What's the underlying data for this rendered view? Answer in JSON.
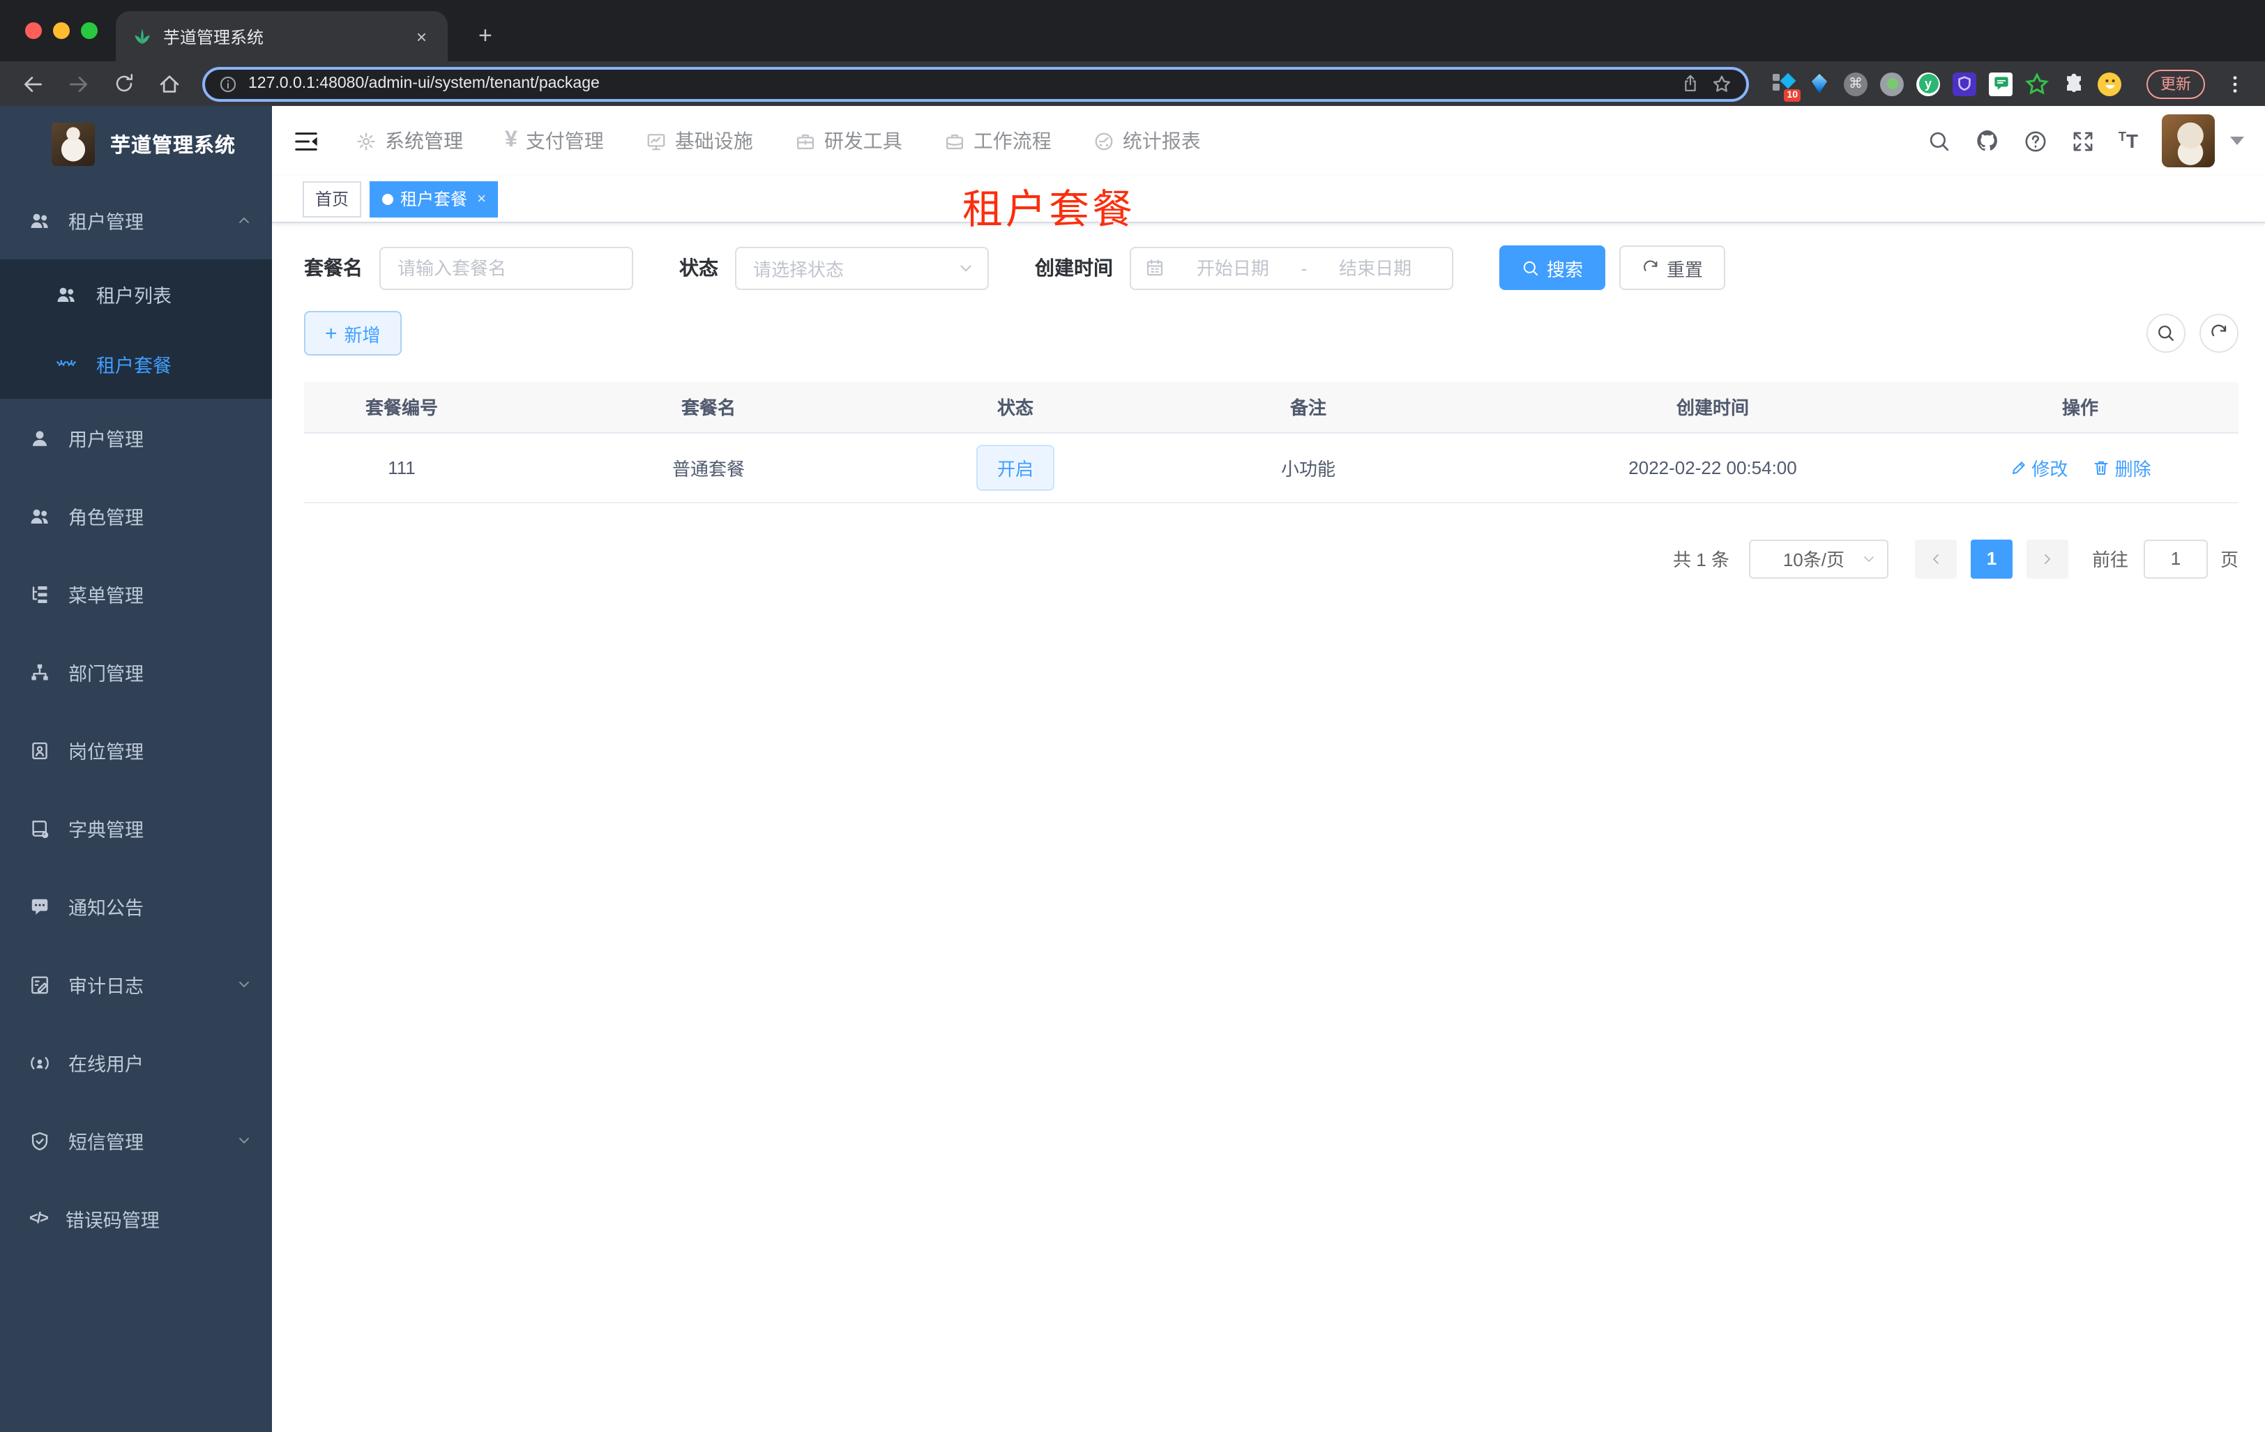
{
  "browser": {
    "tab_title": "芋道管理系统",
    "close_tab": "×",
    "new_tab_button": "+",
    "url": "127.0.0.1:48080/admin-ui/system/tenant/package",
    "extension_badge": "10",
    "ext_y_letter": "y",
    "command_glyph": "⌘",
    "update_button": "更新"
  },
  "header": {
    "nav": [
      {
        "label": "系统管理",
        "icon": "gear-icon"
      },
      {
        "label": "支付管理",
        "icon": "yen-icon"
      },
      {
        "label": "基础设施",
        "icon": "monitor-icon"
      },
      {
        "label": "研发工具",
        "icon": "toolbox-icon"
      },
      {
        "label": "工作流程",
        "icon": "briefcase-icon"
      },
      {
        "label": "统计报表",
        "icon": "stats-icon"
      }
    ],
    "yen_glyph": "¥"
  },
  "sidebar": {
    "logo_title": "芋道管理系统",
    "tenant_group": {
      "label": "租户管理"
    },
    "tenant_children": [
      {
        "label": "租户列表"
      },
      {
        "label": "租户套餐"
      }
    ],
    "items": [
      {
        "label": "用户管理"
      },
      {
        "label": "角色管理"
      },
      {
        "label": "菜单管理"
      },
      {
        "label": "部门管理"
      },
      {
        "label": "岗位管理"
      },
      {
        "label": "字典管理"
      },
      {
        "label": "通知公告"
      },
      {
        "label": "审计日志"
      },
      {
        "label": "在线用户"
      },
      {
        "label": "短信管理"
      },
      {
        "label": "错误码管理"
      }
    ]
  },
  "tags": {
    "home": "首页",
    "active": "租户套餐",
    "close": "×"
  },
  "annotation": "租户套餐",
  "search": {
    "name_label": "套餐名",
    "name_placeholder": "请输入套餐名",
    "status_label": "状态",
    "status_placeholder": "请选择状态",
    "date_label": "创建时间",
    "date_start": "开始日期",
    "date_sep": "-",
    "date_end": "结束日期",
    "search_button": "搜索",
    "reset_button": "重置"
  },
  "toolbar": {
    "add_button": "新增"
  },
  "table": {
    "headers": [
      "套餐编号",
      "套餐名",
      "状态",
      "备注",
      "创建时间",
      "操作"
    ],
    "rows": [
      {
        "id": "111",
        "name": "普通套餐",
        "status": "开启",
        "remark": "小功能",
        "created": "2022-02-22 00:54:00",
        "edit": "修改",
        "delete": "删除"
      }
    ]
  },
  "pagination": {
    "total": "共 1 条",
    "page_size": "10条/页",
    "current_page": "1",
    "goto_label": "前往",
    "goto_value": "1",
    "unit_label": "页"
  },
  "icons": {
    "plus": "+",
    "code": "</>"
  },
  "colors": {
    "primary": "#409eff",
    "sidebar_bg": "#304156",
    "submenu_bg": "#1f2d3d",
    "annotation_red": "#fb2e0e",
    "status_tag_bg": "#ecf5ff"
  }
}
